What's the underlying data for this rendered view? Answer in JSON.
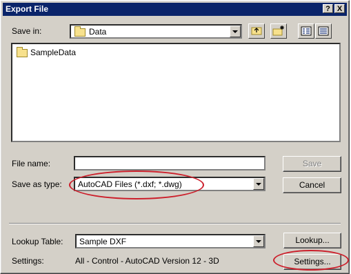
{
  "window": {
    "title": "Export File",
    "help_glyph": "?",
    "close_glyph": "X"
  },
  "save_in": {
    "label": "Save in:",
    "value": "Data"
  },
  "file_list": {
    "items": [
      {
        "name": "SampleData",
        "icon": "folder-icon"
      }
    ]
  },
  "file_name": {
    "label": "File name:",
    "value": ""
  },
  "save_as_type": {
    "label": "Save as type:",
    "value": "AutoCAD Files (*.dxf; *.dwg)"
  },
  "buttons": {
    "save": "Save",
    "cancel": "Cancel",
    "lookup": "Lookup...",
    "settings": "Settings..."
  },
  "lookup_table": {
    "label": "Lookup Table:",
    "value": "Sample DXF"
  },
  "settings": {
    "label": "Settings:",
    "value": "All - Control - AutoCAD Version 12 - 3D"
  },
  "colors": {
    "titlebar": "#0a246a",
    "face": "#d4d0c8",
    "highlight_ellipse": "#cc1f2b"
  }
}
